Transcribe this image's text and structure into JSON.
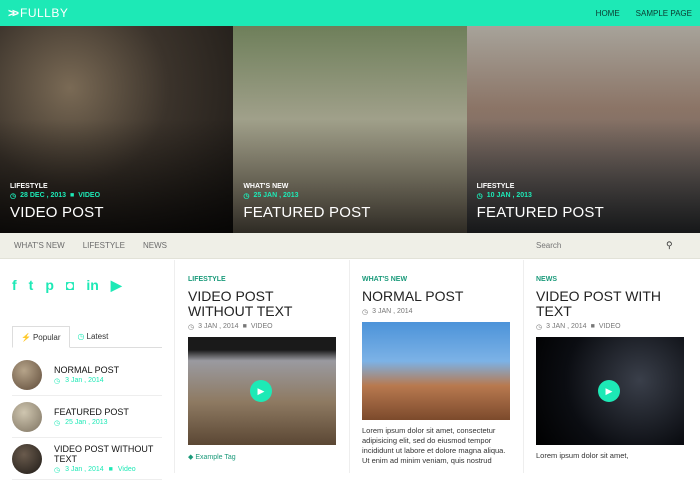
{
  "brand": {
    "name": "FULLBY",
    "accent": "#1de9b6"
  },
  "topnav": [
    "HOME",
    "SAMPLE PAGE"
  ],
  "hero": [
    {
      "category": "LIFESTYLE",
      "date": "28 DEC , 2013",
      "type": "VIDEO",
      "title": "VIDEO POST"
    },
    {
      "category": "WHAT'S NEW",
      "date": "25 JAN , 2013",
      "type": "",
      "title": "FEATURED POST"
    },
    {
      "category": "LIFESTYLE",
      "date": "10 JAN , 2013",
      "type": "",
      "title": "FEATURED POST"
    }
  ],
  "catbar": {
    "links": [
      "WHAT'S NEW",
      "LIFESTYLE",
      "NEWS"
    ],
    "search_placeholder": "Search"
  },
  "sidebar": {
    "tabs": [
      "Popular",
      "Latest"
    ],
    "items": [
      {
        "title": "NORMAL POST",
        "date": "3 Jan , 2014",
        "type": ""
      },
      {
        "title": "FEATURED POST",
        "date": "25 Jan , 2013",
        "type": ""
      },
      {
        "title": "VIDEO POST WITHOUT TEXT",
        "date": "3 Jan , 2014",
        "type": "Video"
      }
    ]
  },
  "posts": [
    {
      "category": "LIFESTYLE",
      "title": "VIDEO POST WITHOUT TEXT",
      "date": "3 JAN , 2014",
      "type": "VIDEO",
      "excerpt": "",
      "tag": "Example Tag"
    },
    {
      "category": "WHAT'S NEW",
      "title": "NORMAL POST",
      "date": "3 JAN , 2014",
      "type": "",
      "excerpt": "Lorem ipsum dolor sit amet, consectetur adipisicing elit, sed do eiusmod tempor incididunt ut labore et dolore magna aliqua. Ut enim ad minim veniam, quis nostrud",
      "tag": ""
    },
    {
      "category": "NEWS",
      "title": "VIDEO POST WITH TEXT",
      "date": "3 JAN , 2014",
      "type": "VIDEO",
      "excerpt": "Lorem ipsum dolor sit amet,",
      "tag": ""
    }
  ]
}
